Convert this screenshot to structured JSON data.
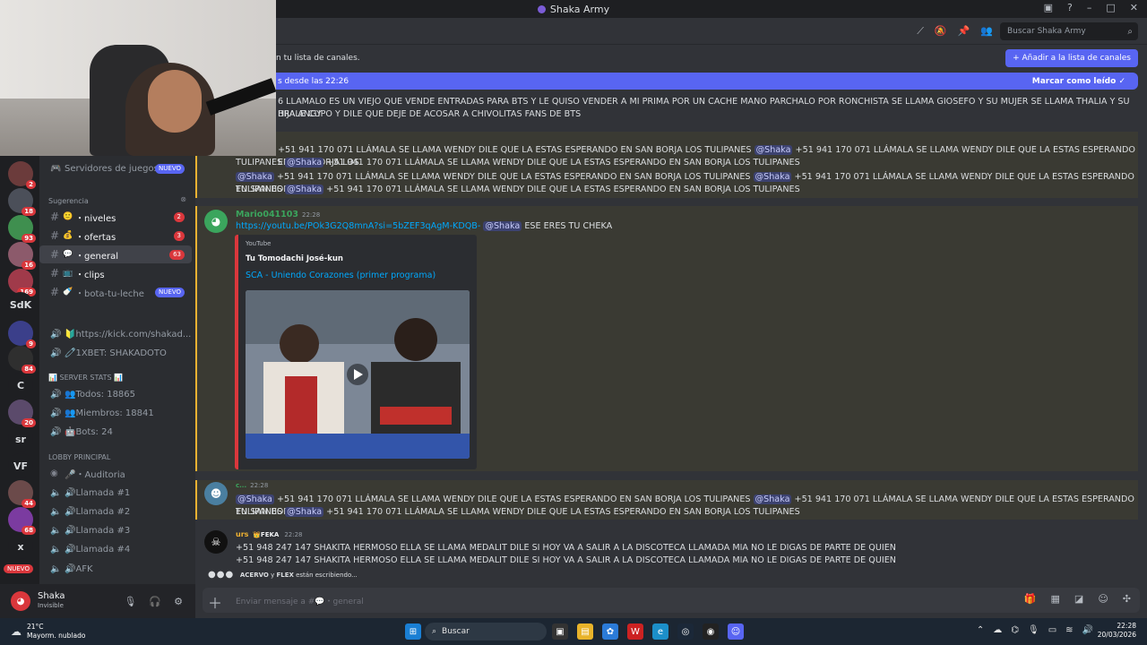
{
  "window": {
    "title": "Shaka Army",
    "controls": [
      "▣",
      "?",
      "–",
      "□",
      "✕"
    ]
  },
  "header": {
    "search_placeholder": "Buscar Shaka Army",
    "notice_text": "n tu lista de canales.",
    "add_button": "+  Añadir a la lista de canales",
    "new_since": "s desde las 22:26",
    "mark_read": "Marcar como leído"
  },
  "rail": {
    "servers": [
      {
        "label": "",
        "badge": "2",
        "color": "#6b3b3b"
      },
      {
        "label": "",
        "badge": "18",
        "color": "#4b4f59"
      },
      {
        "label": "",
        "badge": "93",
        "color": "#3f8f4f"
      },
      {
        "label": "",
        "badge": "16",
        "color": "#8c5a6b"
      },
      {
        "label": "",
        "badge": "169",
        "color": "#a03a4a"
      },
      {
        "label": "SdK",
        "badge": "",
        "color": "#1e1f22"
      },
      {
        "label": "",
        "badge": "9",
        "color": "#3b3f8a"
      },
      {
        "label": "",
        "badge": "84",
        "color": "#2f2f2f"
      },
      {
        "label": "C",
        "badge": "",
        "color": "#1e1f22"
      },
      {
        "label": "",
        "badge": "20",
        "color": "#5b4a6b"
      },
      {
        "label": "sr",
        "badge": "",
        "color": "#1e1f22"
      },
      {
        "label": "VF",
        "badge": "",
        "color": "#1e1f22"
      },
      {
        "label": "",
        "badge": "44",
        "color": "#6b4a4a"
      },
      {
        "label": "",
        "badge": "68",
        "color": "#7b3ba0"
      },
      {
        "label": "x",
        "badge": "",
        "color": "#1e1f22"
      }
    ],
    "nuevo": "NUEVO"
  },
  "sidebar": {
    "game_servers": {
      "label": "Servidores de juegos",
      "badge": "NUEVO"
    },
    "cat_suggestion": "Sugerencia",
    "channels_text": [
      {
        "name": "・niveles",
        "emoji": "🙂",
        "count": "2"
      },
      {
        "name": "・ofertas",
        "emoji": "💰",
        "count": "3"
      },
      {
        "name": "・general",
        "emoji": "💬",
        "count": "63"
      },
      {
        "name": "・clips",
        "emoji": "📺",
        "count": ""
      },
      {
        "name": "・bota-tu-leche",
        "emoji": "🍼",
        "count": "",
        "badge": "NUEVO"
      }
    ],
    "voice_links": [
      {
        "name": "🔰https://kick.com/shakad..."
      },
      {
        "name": "🧷1XBET: SHAKADOTO"
      }
    ],
    "cat_stats": "📊 SERVER STATS 📊",
    "stats": [
      {
        "name": "👥Todos: 18865"
      },
      {
        "name": "👥Miembros: 18841"
      },
      {
        "name": "🤖Bots: 24"
      }
    ],
    "cat_lobby": "LOBBY PRINCIPAL",
    "voice": [
      {
        "name": "🎤・Auditoria"
      },
      {
        "name": "🔊Llamada #1"
      },
      {
        "name": "🔊Llamada #2"
      },
      {
        "name": "🔊Llamada #3"
      },
      {
        "name": "🔊Llamada #4"
      },
      {
        "name": "🔊AFK"
      }
    ]
  },
  "user": {
    "name": "Shaka",
    "status": "Invisible"
  },
  "messages": {
    "m1_line1": "6 LLAMALO ES UN VIEJO QUE VENDE ENTRADAS PARA BTS Y LE QUISO VENDER A MI PRIMA POR UN CACHE MANO PARCHALO POR RONCHISTA SE LLAMA GIOSEFO Y SU MUJER SE LLAMA THALIA Y SU HIJA ANGY",
    "m1_line2": "BRALE CUPO Y DILE QUE DEJE DE ACOSAR A CHIVOLITAS FANS DE BTS",
    "spam": "+51 941 170 071 LLÁMALA SE LLAMA WENDY DILE QUE LA ESTAS ESPERANDO EN SAN BORJA LOS TULIPANES",
    "spam_head": "+51 941 170 071 LLÁMALA SE LLAMA WENDY DILE QUE LA ESTAS ESPERANDO EN SAN BORJA LOS",
    "spam_tail": "TULIPANES",
    "mention": "@Shaka",
    "mario_name": "Mario041103",
    "mario_time": "22:28",
    "mario_link": "https://youtu.be/POk3G2Q8mnA?si=5bZEF3qAgM-KDQB-",
    "mario_text": "ESE ERES TU CHEKA",
    "embed_provider": "YouTube",
    "embed_author": "Tu Tomodachi José-kun",
    "embed_title": "SCA - Uniendo Corazones (primer programa)",
    "c_name": "c...",
    "c_time": "22:28",
    "urs_name": "urs",
    "urs_tag": "👑FEKA",
    "urs_time": "22:28",
    "urs_text": "+51 948 247 147 SHAKITA HERMOSO ELLA SE LLAMA MEDALIT DILE SI HOY VA A SALIR A LA DISCOTECA LLAMADA MIA NO LE DIGAS DE PARTE DE QUIEN",
    "typing_users": "ACERVO",
    "typing_and": " y ",
    "typing_user2": "FLEX",
    "typing_suffix": " están escribiendo..."
  },
  "composer": {
    "placeholder": "Enviar mensaje a #💬・general"
  },
  "taskbar": {
    "temp": "21°C",
    "weather": "Mayorm. nublado",
    "search": "Buscar",
    "time": "22:28",
    "date": "20/03/2026"
  },
  "colors": {
    "accent": "#5865f2",
    "mention_bg": "#3c4270",
    "highlight_bar": "#f0b232",
    "badge_red": "#da373c",
    "mario_name": "#3ba55d",
    "urs_name": "#f0b232",
    "c_name": "#3ba55d"
  }
}
